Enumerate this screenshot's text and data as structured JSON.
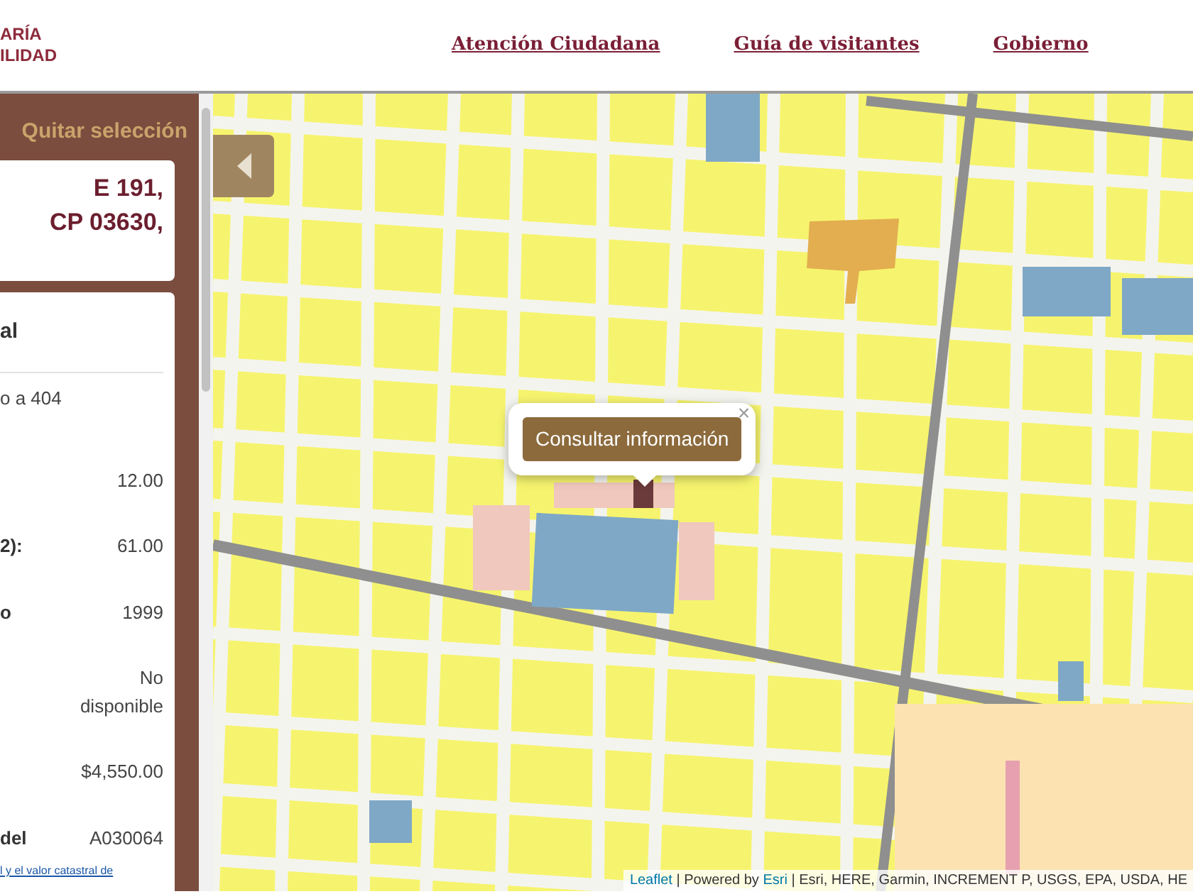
{
  "header": {
    "logo_lines": [
      "ARÍA",
      "ILIDAD"
    ],
    "nav_links": [
      "Atención Ciudadana",
      "Guía de visitantes",
      "Gobierno"
    ]
  },
  "sidebar": {
    "clear_link": "Quitar selección",
    "address_lines": [
      "E 191,",
      "CP 03630,"
    ],
    "info_card": {
      "title": "al",
      "subtitle": "o a 404",
      "rows": [
        {
          "label": "",
          "value": "12.00"
        },
        {
          "label": "2):",
          "value": "61.00"
        },
        {
          "label": "o",
          "value": "1999"
        },
        {
          "label": "",
          "value": "No disponible"
        },
        {
          "label": "",
          "value": "$4,550.00"
        },
        {
          "label": "del",
          "value": "A030064"
        }
      ],
      "footnote": "l y el valor catastral de"
    }
  },
  "map": {
    "popup": {
      "button": "Consultar información",
      "close": "×"
    },
    "attribution": [
      {
        "text": "Leaflet",
        "link": true
      },
      {
        "text": " | Powered by ",
        "link": false
      },
      {
        "text": "Esri",
        "link": true
      },
      {
        "text": " | Esri, HERE, Garmin, INCREMENT P, USGS, EPA, USDA, HE",
        "link": false
      }
    ]
  }
}
